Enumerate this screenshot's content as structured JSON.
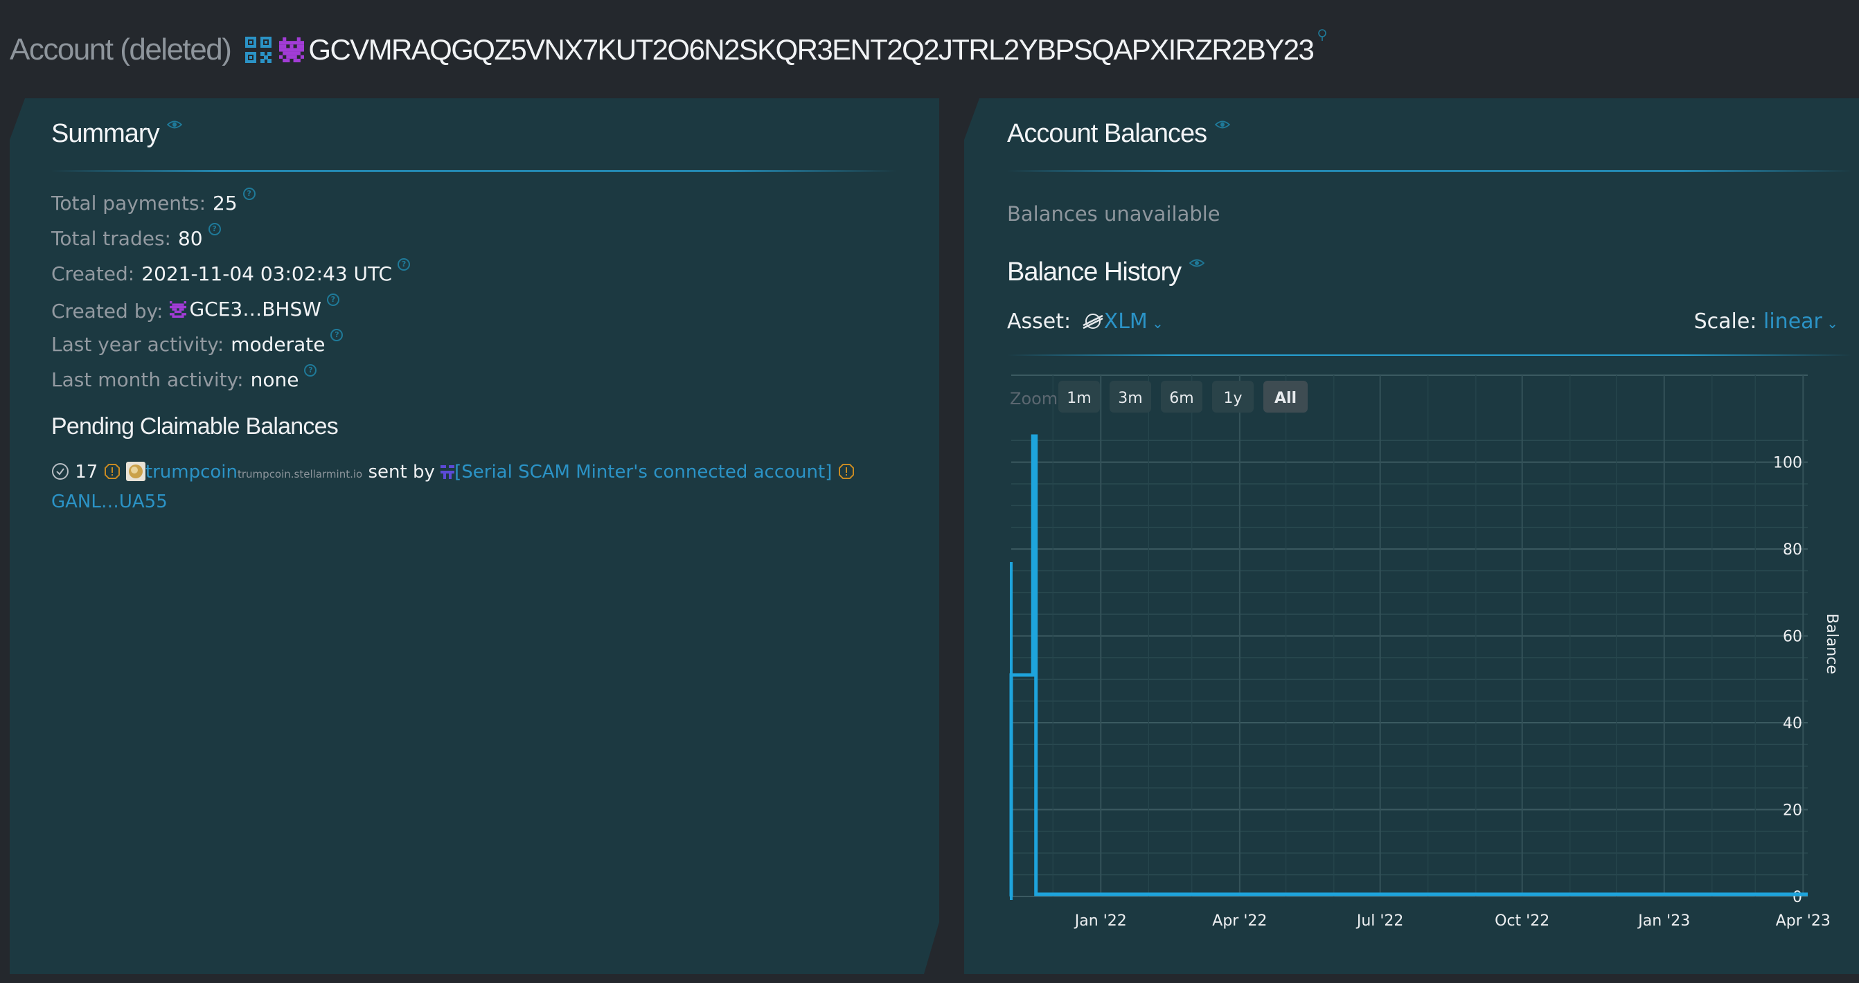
{
  "header": {
    "prefix": "Account (deleted)",
    "address": "GCVMRAQGQZ5VNX7KUT2O6N2SKQR3ENT2Q2JTRL2YBPSQAPXIRZR2BY23",
    "qr_icon": "qr-code-icon",
    "identicon_color": "#a23cd6"
  },
  "summary": {
    "title": "Summary",
    "rows": [
      {
        "label": "Total payments:",
        "value": "25"
      },
      {
        "label": "Total trades:",
        "value": "80"
      },
      {
        "label": "Created:",
        "value": "2021-11-04 03:02:43 UTC"
      },
      {
        "label": "Created by:",
        "value": "GCE3…BHSW"
      },
      {
        "label": "Last year activity:",
        "value": "moderate"
      },
      {
        "label": "Last month activity:",
        "value": "none"
      }
    ],
    "pending": {
      "title": "Pending Claimable Balances",
      "amount": "17",
      "asset": "trumpcoin",
      "domain": "trumpcoin.stellarmint.io",
      "sent_by": "sent by",
      "sender": "[Serial SCAM Minter's connected account]",
      "recipient": "GANL…UA55"
    }
  },
  "balances": {
    "title": "Account Balances",
    "unavailable": "Balances unavailable",
    "history_title": "Balance History",
    "asset_label": "Asset:",
    "asset_value": "XLM",
    "scale_label": "Scale:",
    "scale_value": "linear",
    "zoom_label": "Zoom",
    "zoom_buttons": [
      "1m",
      "3m",
      "6m",
      "1y",
      "All"
    ],
    "zoom_active": "All"
  },
  "colors": {
    "accent": "#26a0d2",
    "link": "#2b93c6",
    "panel": "#1c3941",
    "background": "#24282d"
  },
  "chart_data": {
    "type": "line",
    "title": "",
    "xlabel": "",
    "ylabel": "Balance",
    "x_ticks": [
      "Jan '22",
      "Apr '22",
      "Jul '22",
      "Oct '22",
      "Jan '23",
      "Apr '23"
    ],
    "y_ticks": [
      0,
      20,
      40,
      60,
      80,
      100
    ],
    "ylim": [
      0,
      106
    ],
    "xlim": [
      "2021-11-04",
      "2023-04-04"
    ],
    "grid": true,
    "series": [
      {
        "x": [
          "2021-11-04",
          "2021-11-04",
          "2021-11-18",
          "2021-11-18",
          "2021-11-20",
          "2021-11-20",
          "2023-04-04"
        ],
        "values": [
          0,
          51,
          51,
          106,
          106,
          0.5,
          0.5
        ]
      }
    ]
  }
}
